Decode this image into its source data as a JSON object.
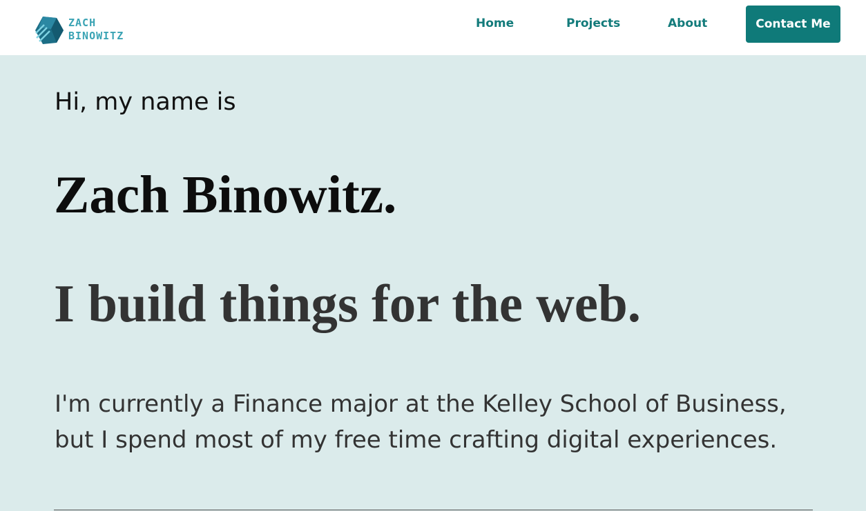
{
  "brand": {
    "line1": "ZACH",
    "line2": "BINOWITZ",
    "logo_icon": "cube-logo-icon",
    "color": "#3aa3b4"
  },
  "nav": {
    "items": [
      {
        "label": "Home"
      },
      {
        "label": "Projects"
      },
      {
        "label": "About"
      }
    ],
    "contact_label": "Contact Me",
    "link_color": "#137b7b",
    "button_color": "#0f7a79"
  },
  "hero": {
    "intro": "Hi, my name is",
    "name": "Zach Binowitz.",
    "tagline": "I build things for the web.",
    "bio": "I'm currently a Finance major at the Kelley School of Business, but I spend most of my free time crafting digital experiences.",
    "background_color": "#dbebeb"
  }
}
